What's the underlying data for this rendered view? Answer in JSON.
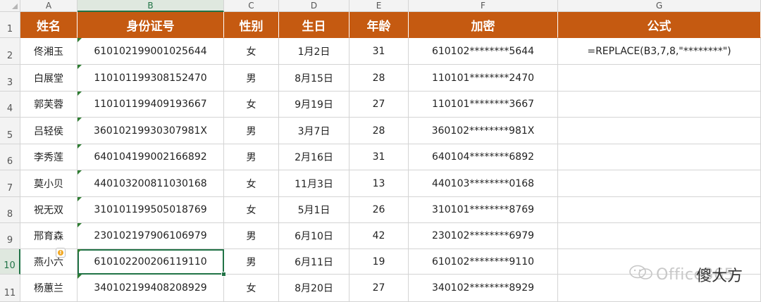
{
  "columns": [
    "A",
    "B",
    "C",
    "D",
    "E",
    "F",
    "G"
  ],
  "rows": [
    "1",
    "2",
    "3",
    "4",
    "5",
    "6",
    "7",
    "8",
    "9",
    "10",
    "11"
  ],
  "headers": [
    "姓名",
    "身份证号",
    "性别",
    "生日",
    "年龄",
    "加密",
    "公式"
  ],
  "data": [
    [
      "佟湘玉",
      "610102199001025644",
      "女",
      "1月2日",
      "31",
      "610102********5644",
      "=REPLACE(B3,7,8,\"********\")"
    ],
    [
      "白展堂",
      "110101199308152470",
      "男",
      "8月15日",
      "28",
      "110101********2470",
      ""
    ],
    [
      "郭芙蓉",
      "110101199409193667",
      "女",
      "9月19日",
      "27",
      "110101********3667",
      ""
    ],
    [
      "吕轻侯",
      "36010219930307981X",
      "男",
      "3月7日",
      "28",
      "360102********981X",
      ""
    ],
    [
      "李秀莲",
      "640104199002166892",
      "男",
      "2月16日",
      "31",
      "640104********6892",
      ""
    ],
    [
      "莫小贝",
      "440103200811030168",
      "女",
      "11月3日",
      "13",
      "440103********0168",
      ""
    ],
    [
      "祝无双",
      "310101199505018769",
      "女",
      "5月1日",
      "26",
      "310101********8769",
      ""
    ],
    [
      "邢育森",
      "230102197906106979",
      "男",
      "6月10日",
      "42",
      "230102********6979",
      ""
    ],
    [
      "燕小六",
      "610102200206119110",
      "男",
      "6月11日",
      "19",
      "610102********9110",
      ""
    ],
    [
      "杨蕙兰",
      "340102199408208929",
      "女",
      "8月20日",
      "27",
      "340102********8929",
      ""
    ]
  ],
  "watermark": {
    "text_light": "Office365",
    "text_dark": "傻大方"
  },
  "colors": {
    "header_bg": "#c55a11",
    "header_text": "#ffffff",
    "selection": "#217346"
  },
  "selected_cell": "B10"
}
